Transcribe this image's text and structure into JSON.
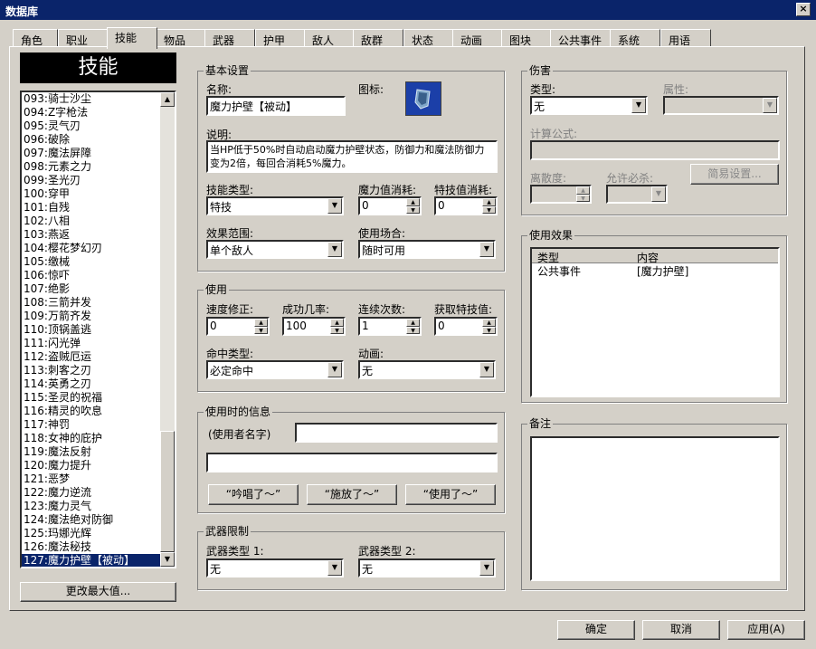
{
  "window": {
    "title": "数据库",
    "close_label": "×"
  },
  "tabs": [
    {
      "label": "角色"
    },
    {
      "label": "职业"
    },
    {
      "label": "技能"
    },
    {
      "label": "物品"
    },
    {
      "label": "武器"
    },
    {
      "label": "护甲"
    },
    {
      "label": "敌人"
    },
    {
      "label": "敌群"
    },
    {
      "label": "状态"
    },
    {
      "label": "动画"
    },
    {
      "label": "图块"
    },
    {
      "label": "公共事件"
    },
    {
      "label": "系统"
    },
    {
      "label": "用语"
    }
  ],
  "active_tab": "技能",
  "skill_list": {
    "header": "技能",
    "items": [
      "093:骑士沙尘",
      "094:Z字枪法",
      "095:灵气刃",
      "096:破除",
      "097:魔法屏障",
      "098:元素之力",
      "099:圣光刃",
      "100:穿甲",
      "101:自残",
      "102:八相",
      "103:燕返",
      "104:樱花梦幻刃",
      "105:缴械",
      "106:惊吓",
      "107:绝影",
      "108:三箭并发",
      "109:万箭齐发",
      "110:顶锅盖逃",
      "111:闪光弹",
      "112:盗贼厄运",
      "113:刺客之刃",
      "114:英勇之刃",
      "115:圣灵的祝福",
      "116:精灵的吹息",
      "117:神罚",
      "118:女神的庇护",
      "119:魔法反射",
      "120:魔力提升",
      "121:恶梦",
      "122:魔力逆流",
      "123:魔力灵气",
      "124:魔法绝对防御",
      "125:玛娜光辉",
      "126:魔法秘技",
      "127:魔力护壁【被动】"
    ],
    "selected_index": 34,
    "change_max_button": "更改最大值..."
  },
  "basic": {
    "legend": "基本设置",
    "name_label": "名称:",
    "name_value": "魔力护壁【被动】",
    "icon_label": "图标:",
    "desc_label": "说明:",
    "desc_value": "当HP低于50%时自动启动魔力护壁状态，防御力和魔法防御力变为2倍，每回合消耗5%魔力。",
    "skill_type_label": "技能类型:",
    "skill_type_value": "特技",
    "mp_cost_label": "魔力值消耗:",
    "mp_cost_value": "0",
    "tp_cost_label": "特技值消耗:",
    "tp_cost_value": "0",
    "scope_label": "效果范围:",
    "scope_value": "单个敌人",
    "occasion_label": "使用场合:",
    "occasion_value": "随时可用"
  },
  "invocation": {
    "legend": "使用",
    "speed_label": "速度修正:",
    "speed_value": "0",
    "success_label": "成功几率:",
    "success_value": "100",
    "repeats_label": "连续次数:",
    "repeats_value": "1",
    "tp_gain_label": "获取特技值:",
    "tp_gain_value": "0",
    "hit_type_label": "命中类型:",
    "hit_type_value": "必定命中",
    "animation_label": "动画:",
    "animation_value": "无"
  },
  "message": {
    "legend": "使用时的信息",
    "user_name_label": "(使用者名字)",
    "line1_value": "",
    "line2_value": "",
    "btn_cast": "“吟唱了～”",
    "btn_release": "“施放了～”",
    "btn_use": "“使用了～”"
  },
  "weapon_req": {
    "legend": "武器限制",
    "type1_label": "武器类型 1:",
    "type1_value": "无",
    "type2_label": "武器类型 2:",
    "type2_value": "无"
  },
  "damage": {
    "legend": "伤害",
    "type_label": "类型:",
    "type_value": "无",
    "element_label": "属性:",
    "element_value": "",
    "formula_label": "计算公式:",
    "formula_value": "",
    "variance_label": "离散度:",
    "variance_value": "",
    "critical_label": "允许必杀:",
    "critical_value": "",
    "simple_settings_button": "简易设置..."
  },
  "effects": {
    "legend": "使用效果",
    "col_type": "类型",
    "col_content": "内容",
    "rows": [
      {
        "type": "公共事件",
        "content": "[魔力护壁]"
      }
    ]
  },
  "note": {
    "legend": "备注",
    "value": ""
  },
  "footer": {
    "ok": "确定",
    "cancel": "取消",
    "apply": "应用(A)"
  }
}
